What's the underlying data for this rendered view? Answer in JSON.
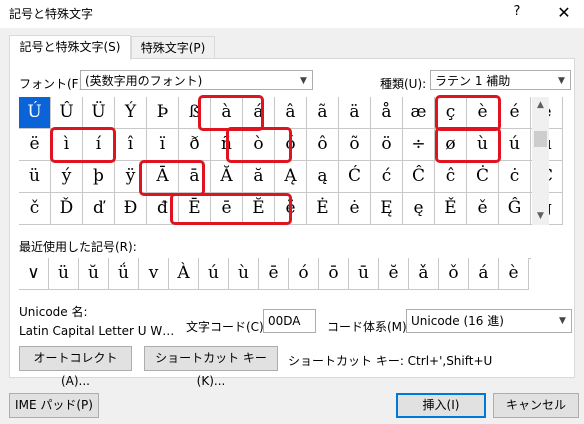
{
  "window": {
    "title": "記号と特殊文字",
    "help": "?",
    "close": "✕"
  },
  "tabs": [
    {
      "label": "記号と特殊文字(S)",
      "active": true
    },
    {
      "label": "特殊文字(P)",
      "active": false
    }
  ],
  "font": {
    "label": "フォント(F):",
    "value": "(英数字用のフォント)"
  },
  "subset": {
    "label": "種類(U):",
    "value": "ラテン 1 補助"
  },
  "symbols": [
    [
      "Ú",
      "Û",
      "Ü",
      "Ý",
      "Þ",
      "ß",
      "à",
      "á",
      "â",
      "ã",
      "ä",
      "å",
      "æ",
      "ç",
      "è",
      "é",
      "ê"
    ],
    [
      "ë",
      "ì",
      "í",
      "î",
      "ï",
      "ð",
      "ñ",
      "ò",
      "ó",
      "ô",
      "õ",
      "ö",
      "÷",
      "ø",
      "ù",
      "ú",
      "û"
    ],
    [
      "ü",
      "ý",
      "þ",
      "ÿ",
      "Ā",
      "ā",
      "Ă",
      "ă",
      "Ą",
      "ą",
      "Ć",
      "ć",
      "Ĉ",
      "ĉ",
      "Ċ",
      "ċ",
      "Č"
    ],
    [
      "č",
      "Ď",
      "ď",
      "Đ",
      "đ",
      "Ē",
      "ē",
      "Ĕ",
      "ĕ",
      "Ė",
      "ė",
      "Ę",
      "ę",
      "Ě",
      "ě",
      "Ĝ",
      "ĝ"
    ]
  ],
  "recent": {
    "label": "最近使用した記号(R):",
    "items": [
      "∨",
      "ü",
      "ŭ",
      "ǘ",
      "v",
      "À",
      "ú",
      "ù",
      "ē",
      "ó",
      "ō",
      "ū",
      "ĕ",
      "ǎ",
      "ǒ",
      "á",
      "è"
    ]
  },
  "unicode": {
    "name_label": "Unicode 名:",
    "name_value": "Latin Capital Letter U W…",
    "code_label": "文字コード(C):",
    "code_value": "00DA",
    "system_label": "コード体系(M):",
    "system_value": "Unicode (16 進)"
  },
  "buttons": {
    "autocorrect": "オートコレクト(A)...",
    "shortcut_key": "ショートカット キー(K)...",
    "shortcut_text": "ショートカット キー: Ctrl+',Shift+U",
    "ime_pad": "IME パッド(P)",
    "insert": "挿入(I)",
    "cancel": "キャンセル"
  },
  "colors": {
    "selection": "#0a64d8",
    "highlight": "#e0141e"
  }
}
